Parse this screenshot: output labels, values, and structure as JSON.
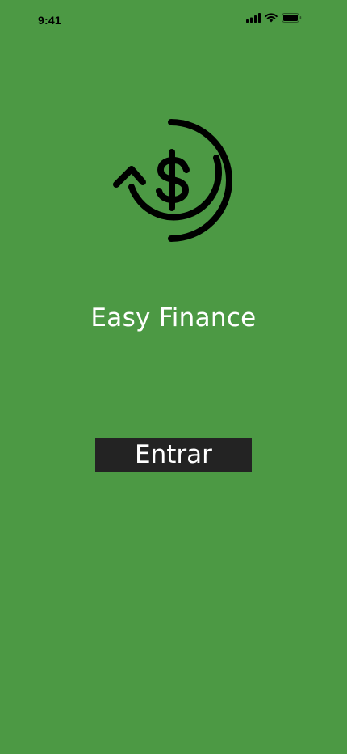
{
  "status_bar": {
    "time": "9:41",
    "icons": [
      "signal-icon",
      "wifi-icon",
      "battery-icon"
    ]
  },
  "logo": {
    "icon": "dollar-refresh-icon"
  },
  "app": {
    "title": "Easy Finance"
  },
  "actions": {
    "enter_label": "Entrar"
  },
  "colors": {
    "background": "#4c9944",
    "button_background": "#232323",
    "text": "#ffffff",
    "icon": "#000000"
  }
}
